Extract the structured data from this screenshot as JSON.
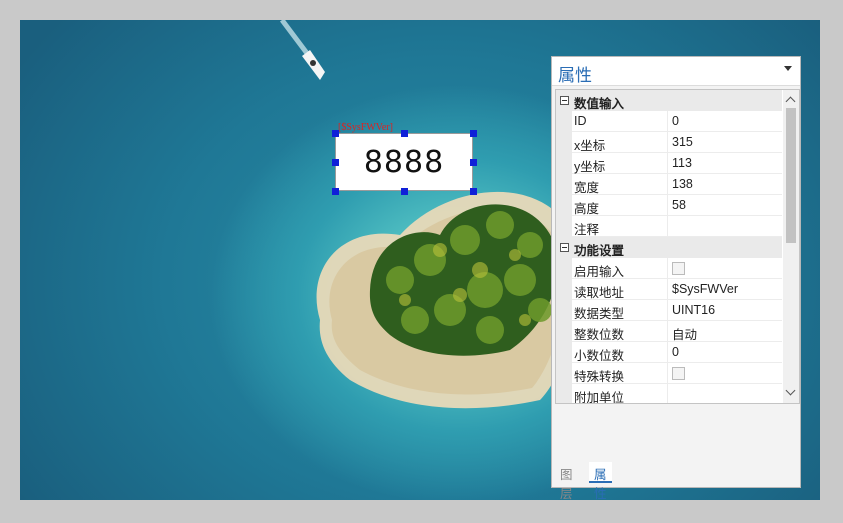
{
  "canvas": {
    "widget_tag": "[$SysFWVer]",
    "widget_value": "8888"
  },
  "panel": {
    "title": "属性",
    "categories": [
      {
        "label": "数值输入",
        "props": [
          {
            "name": "ID",
            "value": "0"
          },
          {
            "name": "x坐标",
            "value": "315"
          },
          {
            "name": "y坐标",
            "value": "113"
          },
          {
            "name": "宽度",
            "value": "138"
          },
          {
            "name": "高度",
            "value": "58"
          },
          {
            "name": "注释",
            "value": ""
          }
        ]
      },
      {
        "label": "功能设置",
        "props": [
          {
            "name": "启用输入",
            "value": "",
            "checkbox": true
          },
          {
            "name": "读取地址",
            "value": "$SysFWVer"
          },
          {
            "name": "数据类型",
            "value": "UINT16"
          },
          {
            "name": "整数位数",
            "value": "自动"
          },
          {
            "name": "小数位数",
            "value": "0"
          },
          {
            "name": "特殊转换",
            "value": "",
            "checkbox": true
          },
          {
            "name": "附加单位",
            "value": ""
          }
        ]
      }
    ],
    "tabs": [
      {
        "label": "图层",
        "active": false
      },
      {
        "label": "属性",
        "active": true
      }
    ]
  }
}
